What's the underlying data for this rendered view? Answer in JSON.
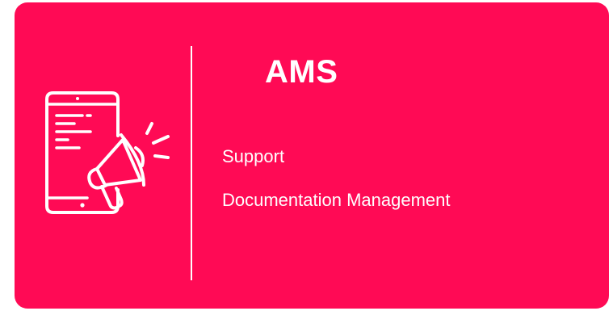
{
  "card": {
    "background": "#ff0a55",
    "icon": "phone-megaphone-icon",
    "title": "AMS",
    "items": [
      {
        "label": "Support"
      },
      {
        "label": "Documentation Management"
      }
    ]
  }
}
